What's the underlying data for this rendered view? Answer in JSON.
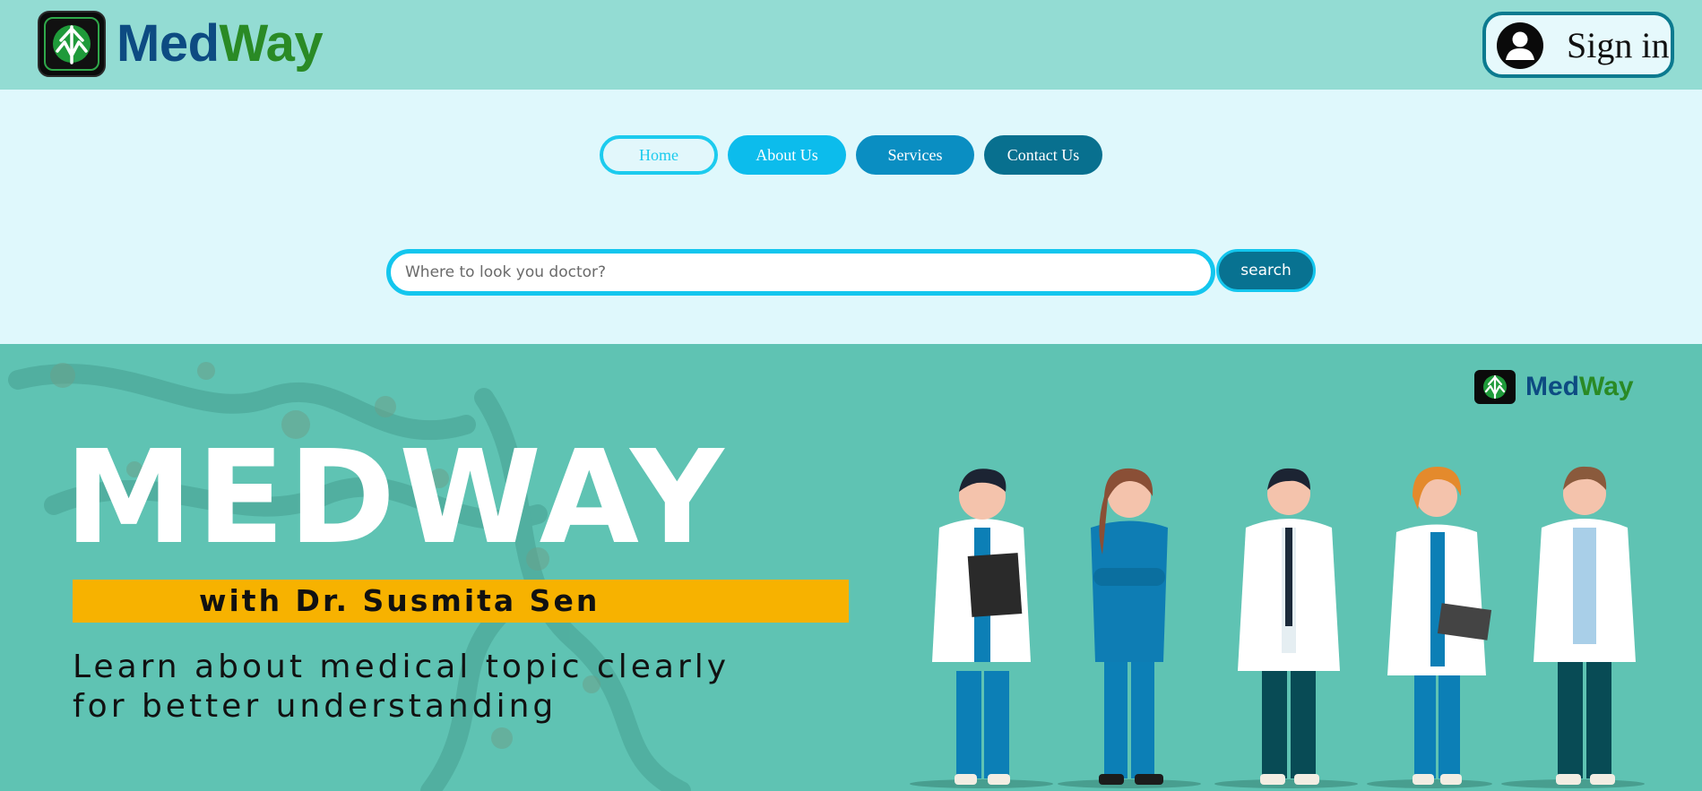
{
  "header": {
    "brand_part1": "Med",
    "brand_part2": "Way",
    "logo_icon": "medway-logo-icon",
    "signin_label": "Sign in",
    "signin_icon": "user-avatar-icon"
  },
  "nav": {
    "items": [
      {
        "label": "Home",
        "active": true
      },
      {
        "label": "About Us"
      },
      {
        "label": "Services"
      },
      {
        "label": "Contact Us"
      }
    ]
  },
  "search": {
    "placeholder": "Where to look you doctor?",
    "value": "",
    "button_label": "search"
  },
  "banner": {
    "brand_part1": "Med",
    "brand_part2": "Way",
    "title": "MEDWAY",
    "subtitle": "with Dr. Susmita Sen",
    "tagline_line1": "Learn about medical topic clearly",
    "tagline_line2": "for better understanding"
  },
  "colors": {
    "header_bg": "#93dcd3",
    "page_bg": "#dff8fc",
    "banner_bg": "#5fc3b3",
    "brand_blue": "#0d4b82",
    "brand_green": "#2a8a25",
    "accent_cyan": "#13c6ee",
    "highlight_yellow": "#f7b200"
  }
}
